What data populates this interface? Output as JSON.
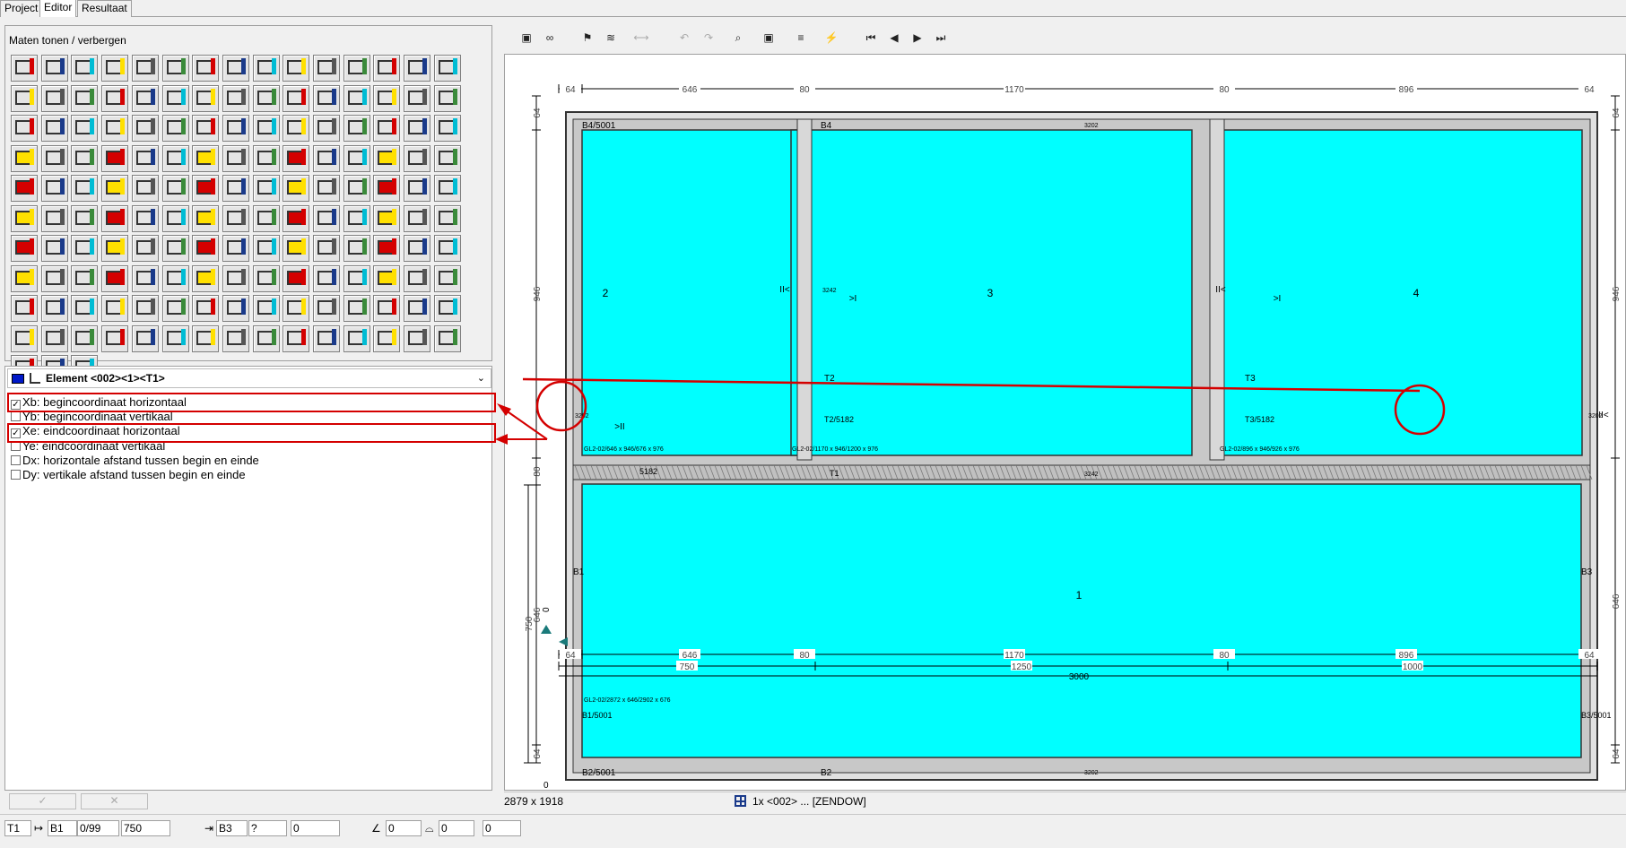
{
  "tabs": [
    {
      "label": "Project"
    },
    {
      "label": "Editor"
    },
    {
      "label": "Resultaat"
    }
  ],
  "toolbox": {
    "title": "Maten tonen / verbergen"
  },
  "element_selector": {
    "label": "Element <002><1><T1>"
  },
  "options": [
    {
      "label": "Xb: begincoordinaat horizontaal",
      "checked": true
    },
    {
      "label": "Yb: begincoordinaat vertikaal",
      "checked": false
    },
    {
      "label": "Xe: eindcoordinaat horizontaal",
      "checked": true
    },
    {
      "label": "Ye: eindcoordinaat vertikaal",
      "checked": false
    },
    {
      "label": "Dx: horizontale afstand tussen begin en einde",
      "checked": false
    },
    {
      "label": "Dy: vertikale afstand tussen begin en einde",
      "checked": false
    }
  ],
  "buttons": {
    "ok": "✓",
    "cancel": "✕"
  },
  "toolbar": [
    "frame-icon",
    "glasses-icon",
    "paint-icon",
    "layers-icon",
    "width-icon",
    "undo-icon",
    "redo-icon",
    "zoom-icon",
    "select-icon",
    "align-icon",
    "lightning-icon",
    "first-icon",
    "prev-icon",
    "next-icon",
    "last-icon"
  ],
  "drawing": {
    "top_dims": [
      "64",
      "646",
      "80",
      "1170",
      "80",
      "896",
      "64"
    ],
    "bottom_dims": [
      "64",
      "646",
      "80",
      "1170",
      "80",
      "896",
      "64"
    ],
    "bottom_totals": [
      "750",
      "1250",
      "1000"
    ],
    "bottom_overall": "3000",
    "left_dims": [
      "64",
      "946",
      "80",
      "646",
      "64"
    ],
    "left_total": "750",
    "right_dims": [
      "64",
      "946",
      "646",
      "64"
    ],
    "origin_x": "0",
    "origin_y": "0",
    "panel_numbers": [
      "2",
      "3",
      "4",
      "1"
    ],
    "frame_labels": {
      "top_left": "B4/5001",
      "top_mid": "B4",
      "top_code": "3202",
      "bottom_left": "B2/5001",
      "bottom_mid": "B2",
      "bottom_code": "3202",
      "left": "B1",
      "right": "B3",
      "left_bottom": "B1/5001",
      "right_bottom": "B3/5001",
      "m1": "T2",
      "m2": "T3",
      "m1_code": "T2/5182",
      "m2_code": "T3/5182",
      "transom": "5182",
      "transom_code": "3242",
      "mullion_code": "3242",
      "t1": "T1",
      "left_bar_code": "3202",
      "right_bar_code": "3202"
    },
    "glass_labels": [
      "GL2-02/646 x 946/676 x 976",
      "GL2-02/1170 x 946/1200 x 976",
      "GL2-02/896 x 946/926 x 976",
      "GL2-02/2872 x 646/2902 x 676"
    ],
    "hinge_marks": [
      "II<",
      ">I",
      "II<",
      ">I",
      "II<",
      ">II"
    ]
  },
  "status": {
    "size": "2879 x 1918",
    "element": "1x <002> ... [ZENDOW]"
  },
  "bottom": {
    "elem": "T1",
    "begin": "B1",
    "begin_val": "0/99",
    "begin_num": "750",
    "end": "B3",
    "end_val": "?",
    "end_num": "0",
    "angle1": "0",
    "angle2": "0",
    "extra": "0"
  }
}
